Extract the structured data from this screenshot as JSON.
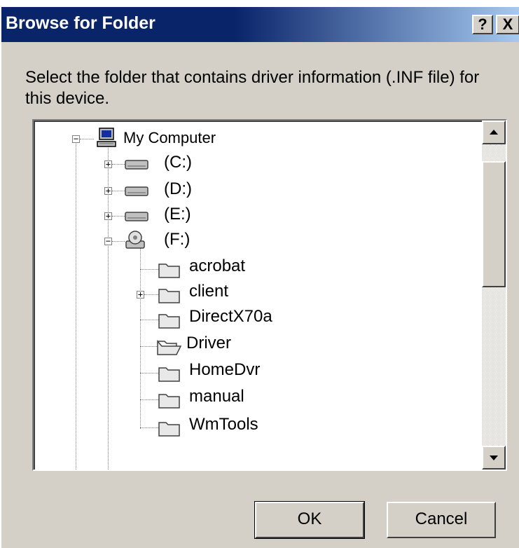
{
  "dialog": {
    "title": "Browse for Folder",
    "help_label": "?",
    "close_label": "X",
    "prompt": "Select the folder that contains driver information (.INF file) for this device.",
    "ok_label": "OK",
    "cancel_label": "Cancel"
  },
  "tree": {
    "root": {
      "label": "My Computer",
      "expander": "−"
    },
    "drives": [
      {
        "label": "(C:)",
        "expander": "+"
      },
      {
        "label": "(D:)",
        "expander": "+"
      },
      {
        "label": "(E:)",
        "expander": "+"
      },
      {
        "label": "(F:)",
        "expander": "−"
      }
    ],
    "folders": [
      {
        "label": "acrobat"
      },
      {
        "label": "client",
        "expander": "+"
      },
      {
        "label": "DirectX70a"
      },
      {
        "label": "Driver",
        "open": true
      },
      {
        "label": "HomeDvr"
      },
      {
        "label": "manual"
      },
      {
        "label": "WmTools"
      }
    ]
  },
  "icons": {
    "computer": "computer-icon",
    "drive": "hard-drive-icon",
    "cd": "cd-drive-icon",
    "folder": "folder-icon",
    "open_folder": "open-folder-icon"
  },
  "colors": {
    "titlebar_start": "#0a246a",
    "titlebar_end": "#a6caf0",
    "face": "#d4d0c8"
  }
}
